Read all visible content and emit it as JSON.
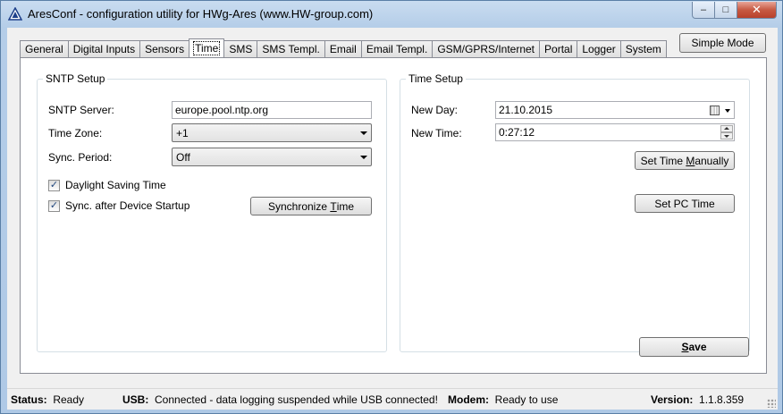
{
  "window": {
    "title": "AresConf - configuration utility for HWg-Ares (www.HW-group.com)",
    "buttons": {
      "minimize": "–",
      "maximize": "□",
      "close": "✕"
    }
  },
  "toolbar": {
    "simple_mode": "Simple Mode"
  },
  "tabs": [
    {
      "label": "General",
      "active": false
    },
    {
      "label": "Digital Inputs",
      "active": false
    },
    {
      "label": "Sensors",
      "active": false
    },
    {
      "label": "Time",
      "active": true
    },
    {
      "label": "SMS",
      "active": false
    },
    {
      "label": "SMS Templ.",
      "active": false
    },
    {
      "label": "Email",
      "active": false
    },
    {
      "label": "Email Templ.",
      "active": false
    },
    {
      "label": "GSM/GPRS/Internet",
      "active": false
    },
    {
      "label": "Portal",
      "active": false
    },
    {
      "label": "Logger",
      "active": false
    },
    {
      "label": "System",
      "active": false
    }
  ],
  "sntp": {
    "group_title": "SNTP Setup",
    "server_label": "SNTP Server:",
    "server_value": "europe.pool.ntp.org",
    "timezone_label": "Time Zone:",
    "timezone_value": "+1",
    "period_label": "Sync. Period:",
    "period_value": "Off",
    "dst_label": "Daylight Saving Time",
    "dst_checked": true,
    "startup_label": "Sync. after Device Startup",
    "startup_checked": true,
    "sync_button_pre": "Synchronize ",
    "sync_button_key": "T",
    "sync_button_post": "ime"
  },
  "time_setup": {
    "group_title": "Time Setup",
    "day_label": "New Day:",
    "day_value": "21.10.2015",
    "time_label": "New Time:",
    "time_value": "0:27:12",
    "set_manual_pre": "Set Time ",
    "set_manual_key": "M",
    "set_manual_post": "anually",
    "set_pc": "Set PC Time"
  },
  "save": {
    "key": "S",
    "rest": "ave"
  },
  "status": {
    "status_label": "Status:",
    "status_value": "Ready",
    "usb_label": "USB:",
    "usb_value": "Connected - data logging suspended while USB connected!",
    "modem_label": "Modem:",
    "modem_value": "Ready to use",
    "version_label": "Version:",
    "version_value": "1.1.8.359"
  },
  "colors": {
    "titlebar": "#b4cde8",
    "close_button": "#c75a43",
    "panel": "#ffffff",
    "client": "#f0f0f0"
  },
  "icons": {
    "app": "triangle-warning-icon",
    "calendar": "calendar-icon",
    "dropdown": "chevron-down-icon",
    "check": "checkmark-icon",
    "spin": "spin-arrows-icon"
  }
}
